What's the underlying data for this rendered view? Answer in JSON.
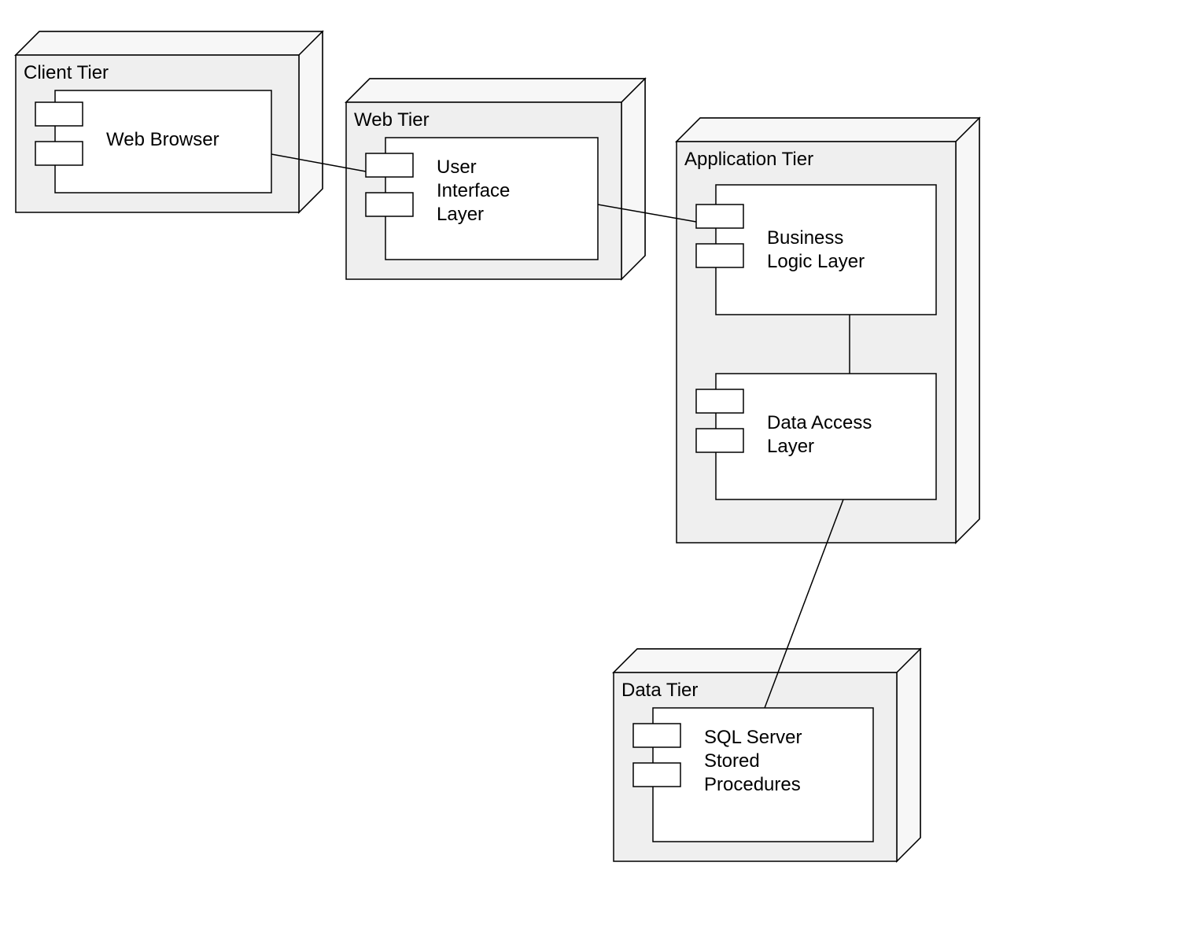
{
  "nodes": {
    "client_tier": {
      "label": "Client Tier",
      "components": {
        "web_browser": {
          "label": "Web Browser"
        }
      }
    },
    "web_tier": {
      "label": "Web Tier",
      "components": {
        "ui_layer": {
          "label_l1": "User",
          "label_l2": "Interface",
          "label_l3": "Layer"
        }
      }
    },
    "application_tier": {
      "label": "Application Tier",
      "components": {
        "business_logic": {
          "label_l1": "Business",
          "label_l2": "Logic Layer"
        },
        "data_access": {
          "label_l1": "Data Access",
          "label_l2": "Layer"
        }
      }
    },
    "data_tier": {
      "label": "Data Tier",
      "components": {
        "sql": {
          "label_l1": "SQL Server",
          "label_l2": "Stored",
          "label_l3": "Procedures"
        }
      }
    }
  }
}
